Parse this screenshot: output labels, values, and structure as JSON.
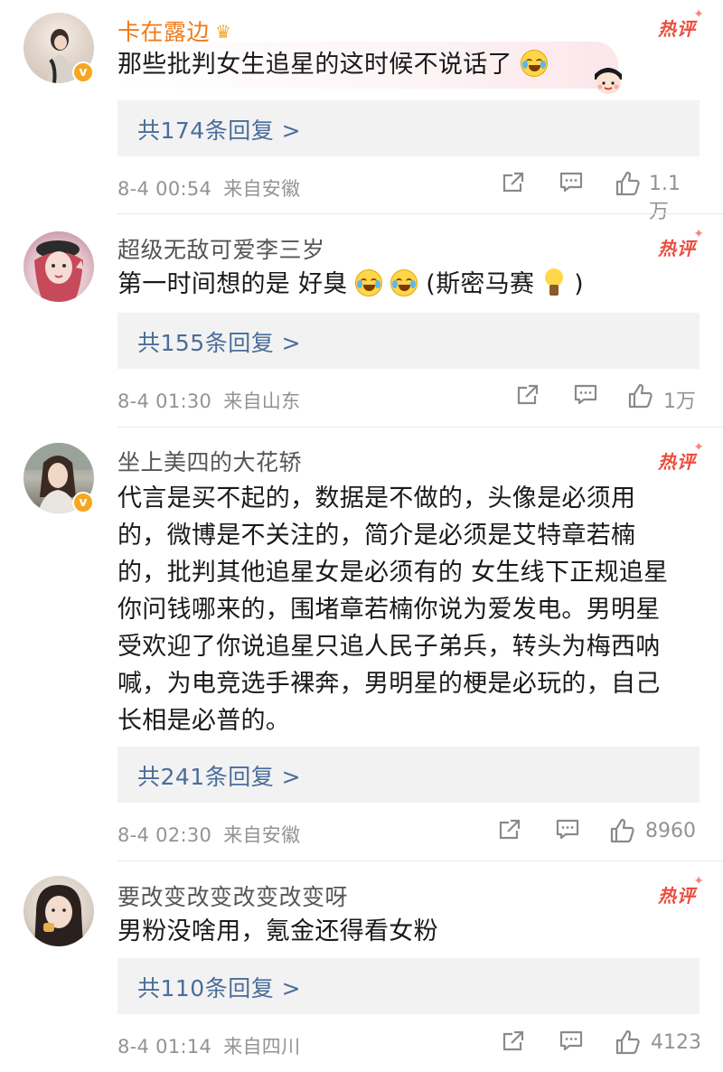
{
  "hot_label": "热评",
  "comments": [
    {
      "username": "卡在露边",
      "text": "那些批判女生追星的这时候不说话了",
      "replies": "共174条回复 >",
      "time": "8-4 00:54",
      "source": "来自安徽",
      "likes": "1.1万",
      "verified": true,
      "vip": true
    },
    {
      "username": "超级无敌可爱李三岁",
      "text_a": "第一时间想的是 好臭",
      "text_b": "(斯密马赛",
      "text_c": ")",
      "replies": "共155条回复 >",
      "time": "8-4 01:30",
      "source": "来自山东",
      "likes": "1万",
      "verified": false
    },
    {
      "username": "坐上美四的大花轿",
      "lines": [
        "代言是买不起的，数据是不做的，头像是必须用",
        "的，微博是不关注的，简介是必须是艾特章若楠",
        "的，批判其他追星女是必须有的 女生线下正规追星",
        "你问钱哪来的，围堵章若楠你说为爱发电。男明星",
        "受欢迎了你说追星只追人民子弟兵，转头为梅西呐",
        "喊，为电竞选手裸奔，男明星的梗是必玩的，自己",
        "长相是必普的。"
      ],
      "replies": "共241条回复 >",
      "time": "8-4 02:30",
      "source": "来自安徽",
      "likes": "8960",
      "verified": true
    },
    {
      "username": "要改变改变改变改变呀",
      "text": "男粉没啥用，氪金还得看女粉",
      "replies": "共110条回复 >",
      "time": "8-4 01:14",
      "source": "来自四川",
      "likes": "4123",
      "verified": false
    }
  ],
  "colors": {
    "vip_name": "#f07a16",
    "name": "#555555",
    "reply_link": "#4a6d99",
    "meta": "#939393",
    "hot": "#ec4d3d",
    "reply_bg": "#f2f2f2"
  }
}
